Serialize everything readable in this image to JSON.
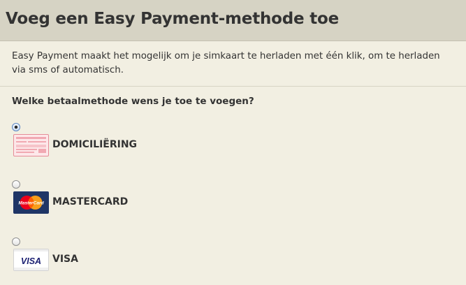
{
  "header": {
    "title": "Voeg een Easy Payment-methode toe"
  },
  "intro": {
    "text": "Easy Payment maakt het mogelijk om je simkaart te herladen met één klik, om te herladen via sms of automatisch."
  },
  "form": {
    "question": "Welke betaalmethode wens je toe te voegen?",
    "methods": [
      {
        "label": "DOMICILIËRING",
        "selected": true,
        "icon": "direct-debit-form-icon"
      },
      {
        "label": "MASTERCARD",
        "selected": false,
        "icon": "mastercard-logo"
      },
      {
        "label": "VISA",
        "selected": false,
        "icon": "visa-logo"
      }
    ]
  },
  "logos": {
    "mastercard_text": "MasterCard",
    "visa_text": "VISA"
  },
  "colors": {
    "background": "#f2efe2",
    "header_background": "#d6d3c4",
    "text": "#333333",
    "radio_selected": "#5c86c2",
    "mastercard_red": "#eb001b",
    "mastercard_orange": "#f79e1b",
    "visa_blue": "#1a1f71",
    "visa_gold": "#f7b600"
  }
}
